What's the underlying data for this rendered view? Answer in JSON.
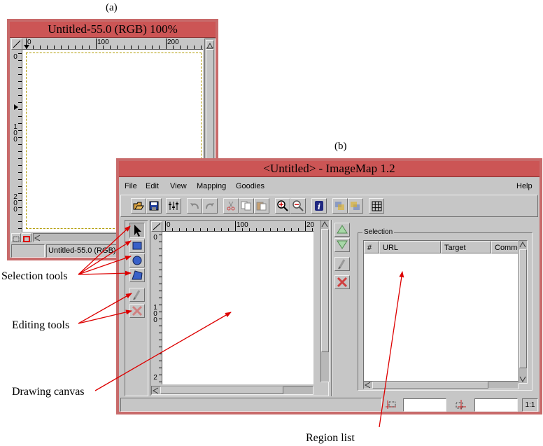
{
  "captions": {
    "a": "(a)",
    "b": "(b)"
  },
  "gimp_window": {
    "title": "Untitled-55.0 (RGB) 100%",
    "ruler_h_labels": [
      "0",
      "100",
      "200"
    ],
    "ruler_v_labels": [
      "0",
      "1\n0\n0",
      "2\n0\n0"
    ],
    "status_text": "Untitled-55.0 (RGB)"
  },
  "imagemap_window": {
    "title": "<Untitled> - ImageMap 1.2",
    "menu": {
      "file": "File",
      "edit": "Edit",
      "view": "View",
      "mapping": "Mapping",
      "goodies": "Goodies",
      "help": "Help"
    },
    "canvas_ruler_h_labels": [
      "0",
      "100",
      "20"
    ],
    "canvas_ruler_v_labels": [
      "0",
      "1\n0\n0",
      "2"
    ],
    "selection_label": "Selection",
    "columns": [
      "#",
      "URL",
      "Target",
      "Comme"
    ],
    "zoom": "1:1"
  },
  "annotations": {
    "selection_tools": "Selection tools",
    "editing_tools": "Editing tools",
    "drawing_canvas": "Drawing canvas",
    "region_list": "Region list"
  },
  "colors": {
    "title_bar": "#cc5555",
    "window_border": "#c86a6a",
    "arrow": "#dd0000"
  }
}
